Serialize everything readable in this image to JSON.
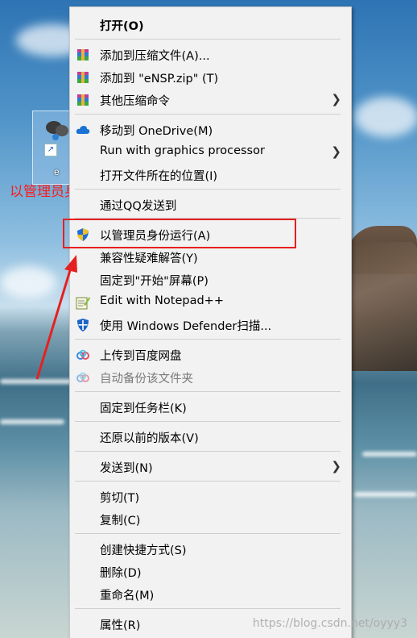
{
  "desktop": {
    "icon_label": "e",
    "annotation": "以管理员身份打开",
    "watermark": "https://blog.csdn.net/oyyy3"
  },
  "menu": {
    "items": [
      {
        "label": "打开(O)",
        "bold": true,
        "icon": "none"
      },
      {
        "label": "添加到压缩文件(A)...",
        "icon": "winrar-icon"
      },
      {
        "label": "添加到 \"eNSP.zip\" (T)",
        "icon": "winrar-icon"
      },
      {
        "label": "其他压缩命令",
        "icon": "winrar-icon",
        "submenu": true
      },
      {
        "label": "移动到 OneDrive(M)",
        "icon": "onedrive-icon"
      },
      {
        "label": "Run with graphics processor",
        "icon": "none",
        "submenu": true
      },
      {
        "label": "打开文件所在的位置(I)",
        "icon": "none"
      },
      {
        "label": "通过QQ发送到",
        "icon": "none"
      },
      {
        "label": "以管理员身份运行(A)",
        "icon": "uac-shield-icon"
      },
      {
        "label": "兼容性疑难解答(Y)",
        "icon": "none"
      },
      {
        "label": "固定到\"开始\"屏幕(P)",
        "icon": "none"
      },
      {
        "label": "Edit with Notepad++",
        "icon": "notepadpp-icon"
      },
      {
        "label": "使用 Windows Defender扫描...",
        "icon": "defender-icon"
      },
      {
        "label": "上传到百度网盘",
        "icon": "baidu-cloud-icon"
      },
      {
        "label": "自动备份该文件夹",
        "icon": "baidu-cloud-icon",
        "disabled": true
      },
      {
        "label": "固定到任务栏(K)",
        "icon": "none"
      },
      {
        "label": "还原以前的版本(V)",
        "icon": "none"
      },
      {
        "label": "发送到(N)",
        "icon": "none",
        "submenu": true
      },
      {
        "label": "剪切(T)",
        "icon": "none"
      },
      {
        "label": "复制(C)",
        "icon": "none"
      },
      {
        "label": "创建快捷方式(S)",
        "icon": "none"
      },
      {
        "label": "删除(D)",
        "icon": "none"
      },
      {
        "label": "重命名(M)",
        "icon": "none"
      },
      {
        "label": "属性(R)",
        "icon": "none"
      }
    ]
  },
  "colors": {
    "annotation_red": "#ff1a1a",
    "menu_bg": "#f2f2f2",
    "separator": "#cfcfcf"
  }
}
